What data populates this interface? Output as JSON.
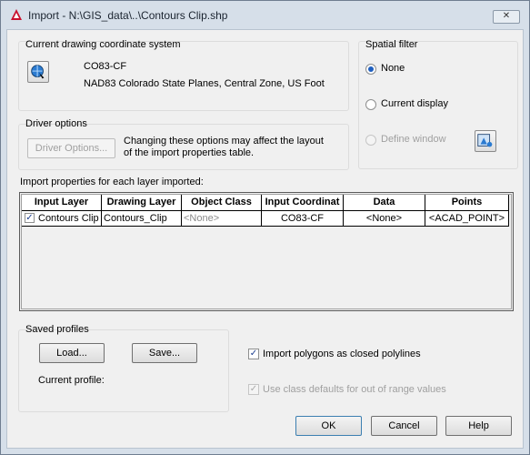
{
  "window": {
    "title": "Import - N:\\GIS_data\\..\\Contours Clip.shp"
  },
  "coordinate_system": {
    "group_label": "Current drawing coordinate system",
    "code": "CO83-CF",
    "description": "NAD83 Colorado State Planes, Central Zone, US Foot"
  },
  "spatial_filter": {
    "group_label": "Spatial filter",
    "options": [
      {
        "label": "None",
        "selected": true,
        "enabled": true
      },
      {
        "label": "Current display",
        "selected": false,
        "enabled": true
      },
      {
        "label": "Define window",
        "selected": false,
        "enabled": false
      }
    ]
  },
  "driver_options": {
    "group_label": "Driver options",
    "button_label": "Driver Options...",
    "note_line1": "Changing these options may affect the layout",
    "note_line2": "of the import properties table."
  },
  "import_table": {
    "label": "Import properties for each layer imported:",
    "columns": [
      "Input Layer",
      "Drawing Layer",
      "Object Class",
      "Input Coordinat",
      "Data",
      "Points"
    ],
    "rows": [
      {
        "checked": true,
        "input_layer": "Contours Clip",
        "drawing_layer": "Contours_Clip",
        "object_class": "<None>",
        "input_coord": "CO83-CF",
        "data": "<None>",
        "points": "<ACAD_POINT>"
      }
    ]
  },
  "saved_profiles": {
    "group_label": "Saved profiles",
    "load_label": "Load...",
    "save_label": "Save...",
    "current_profile_label": "Current profile:"
  },
  "options": {
    "import_polygons_label": "Import polygons as closed polylines",
    "import_polygons_checked": true,
    "class_defaults_label": "Use class defaults for out of range values",
    "class_defaults_checked": true,
    "class_defaults_enabled": false
  },
  "buttons": {
    "ok": "OK",
    "cancel": "Cancel",
    "help": "Help",
    "close": "✕"
  },
  "colors": {
    "accent_red": "#c8102e",
    "radio_blue": "#1f5fbf"
  }
}
